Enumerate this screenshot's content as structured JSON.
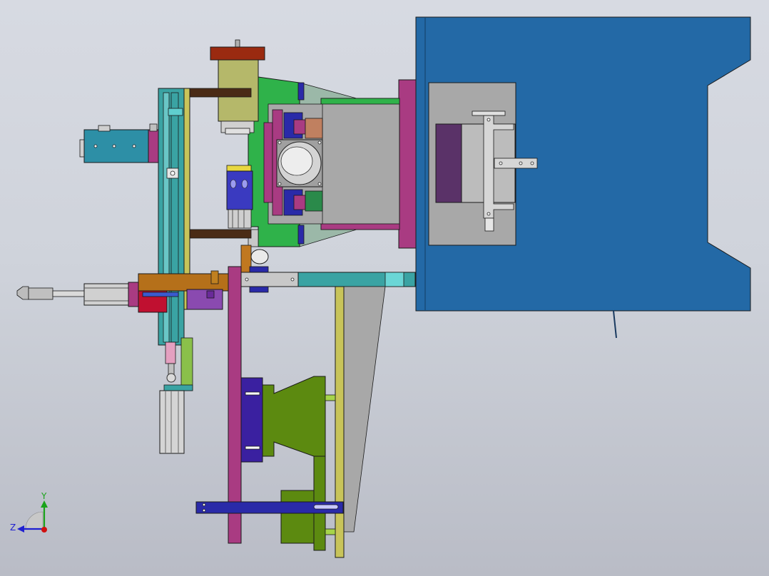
{
  "view": {
    "triad": {
      "y_label": "Y",
      "z_label": "Z",
      "colors": {
        "y": "#1aa31a",
        "z": "#2020d0",
        "x": "#d01010"
      }
    }
  },
  "colors": {
    "blue_frame": "#2369a6",
    "gray_block": "#a8a8a8",
    "magenta": "#a93b82",
    "green": "#2fb24a",
    "olive": "#b5b86a",
    "teal": "#3aa3a3",
    "dark_blue": "#2a2aa8",
    "purple": "#5a3268",
    "lime": "#5c8a10",
    "yellow_bar": "#c8c45a",
    "brown": "#4a2b16",
    "red_cap": "#9a2a10"
  }
}
